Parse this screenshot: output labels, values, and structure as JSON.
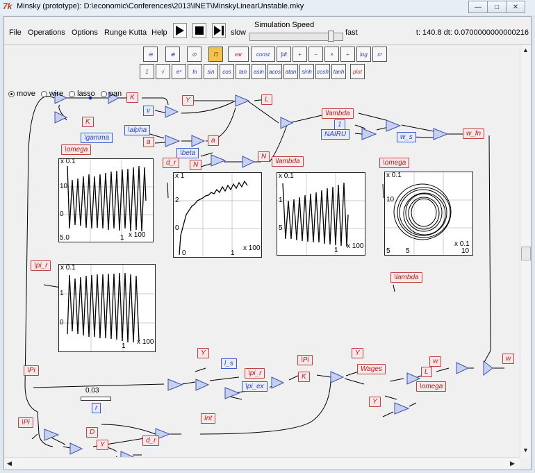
{
  "window": {
    "title": "Minsky (prototype): D:\\economic\\Conferences\\2013\\INET\\MinskyLinearUnstable.mky",
    "icon_glyph": "7k",
    "buttons": {
      "minimize": "—",
      "maximize": "□",
      "close": "✕"
    }
  },
  "menubar": {
    "items": [
      "File",
      "Operations",
      "Options",
      "Runge Kutta",
      "Help"
    ],
    "slow_label": "slow",
    "fast_label": "fast",
    "speed_label": "Simulation Speed",
    "speed_level": 0.9,
    "status": "t: 140.8 dt: 0.0700000000000216"
  },
  "modes": {
    "move": "move",
    "wire": "wire",
    "lasso": "lasso",
    "pan": "pan",
    "selected": "move"
  },
  "palette": {
    "row1": [
      "⊖",
      "⊕",
      "⊙",
      "Π",
      "var",
      "const",
      "∫dt",
      "+",
      "−",
      "×",
      "÷",
      "log",
      "xʸ"
    ],
    "row2": [
      "1",
      "√",
      "eˣ",
      "ln",
      "sin",
      "cos",
      "tan",
      "asin",
      "acos",
      "atan",
      "sinh",
      "cosh",
      "tanh",
      "plot"
    ]
  },
  "variables": {
    "K1": "K",
    "Y1": "Y",
    "K2": "K",
    "gamma": "\\gamma",
    "v": "v",
    "L1": "L",
    "alpha": "\\alpha",
    "a1": "a",
    "a2": "a",
    "beta": "\\beta",
    "N1": "N",
    "N2": "N",
    "lambda1": "\\lambda",
    "one": "1",
    "NAIRU": "NAIRU",
    "w_s": "w_s",
    "w_fn": "w_fn",
    "omega1": "\\omega",
    "d_r1": "d_r",
    "lambda2": "\\lambda",
    "omega2": "\\omega",
    "pi_r1": "\\pi_r",
    "lambda3": "\\lambda",
    "w1": "w",
    "w2": "w",
    "Y2": "Y",
    "Pi1": "\\Pi",
    "Y3": "Y",
    "l_s": "l_s",
    "pi_r2": "\\pi_r",
    "K3": "K",
    "Wages": "Wages",
    "L2": "L",
    "pi_ex": "\\pi_ex",
    "omega3": "\\omega",
    "Y4": "Y",
    "r": "r",
    "Int": "Int",
    "Pi2": "\\Pi",
    "D": "D",
    "Y5": "Y",
    "d_r2": "d_r",
    "Pi3": "\\Pi",
    "r_value": "0.03"
  },
  "plots": {
    "p1": {
      "top": "x 0.1",
      "ymid": "10",
      "ylow": "0",
      "yfloor": "5.0",
      "xright": "x 100",
      "xtick": "1"
    },
    "p2": {
      "top": "x 1",
      "ymid": "2",
      "ylow": "0",
      "xright": "x 100",
      "xtick": "1",
      "xorigin": "0"
    },
    "p3": {
      "top": "x 0.1",
      "ymid": "1",
      "ylow": "5",
      "xright": "x 100",
      "xtick": "1"
    },
    "p4": {
      "top": "x 0.1",
      "ymid": "10",
      "ylow": "5",
      "xright": "x 0.1",
      "xtick1": "5",
      "xtick2": "10"
    },
    "p5": {
      "top": "x 0.1",
      "ymid": "1",
      "ylow": "0",
      "xright": "x 100",
      "xtick": "1"
    }
  },
  "colors": {
    "param": "#2a45b8",
    "variable": "#b22222",
    "wire": "#000000",
    "accent_plot": "#000000"
  }
}
